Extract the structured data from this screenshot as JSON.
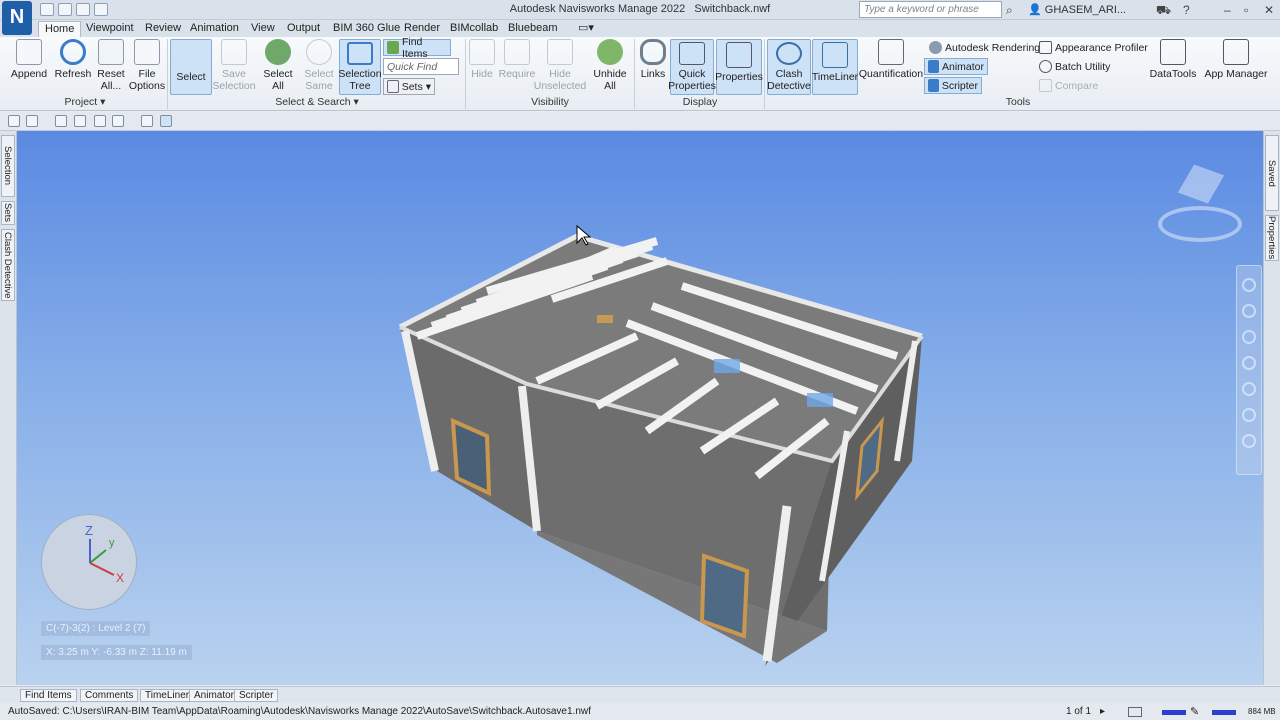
{
  "app": {
    "logo": "N",
    "title": "Autodesk Navisworks Manage 2022",
    "file": "Switchback.nwf",
    "search_placeholder": "Type a keyword or phrase",
    "user": "GHASEM_ARI..."
  },
  "tabs": [
    "Home",
    "Viewpoint",
    "Review",
    "Animation",
    "View",
    "Output",
    "BIM 360 Glue",
    "Render",
    "BIMcollab",
    "Bluebeam"
  ],
  "ribbon": {
    "project": {
      "append": "Append",
      "refresh": "Refresh",
      "reset": "Reset All...",
      "file_options": "File Options",
      "label": "Project"
    },
    "select": {
      "select": "Select",
      "save_selection": "Save Selection",
      "select_all": "Select All",
      "select_same": "Select Same",
      "selection_tree": "Selection Tree",
      "find_items": "Find Items",
      "quick_find": "Quick Find",
      "sets": "Sets",
      "label": "Select & Search"
    },
    "visibility": {
      "hide": "Hide",
      "require": "Require",
      "hide_unselected": "Hide Unselected",
      "unhide_all": "Unhide All",
      "label": "Visibility"
    },
    "display": {
      "links": "Links",
      "quick_properties": "Quick Properties",
      "properties": "Properties",
      "label": "Display"
    },
    "tools": {
      "clash_detective": "Clash Detective",
      "timeliner": "TimeLiner",
      "quantification": "Quantification",
      "autodesk_rendering": "Autodesk Rendering",
      "animator": "Animator",
      "scripter": "Scripter",
      "appearance_profiler": "Appearance Profiler",
      "batch_utility": "Batch Utility",
      "compare": "Compare",
      "datatools": "DataTools",
      "app_manager": "App Manager",
      "label": "Tools"
    }
  },
  "left_dock": [
    "Selection Tree",
    "Sets",
    "Clash Detective"
  ],
  "right_dock": [
    "Saved Viewpoints",
    "Properties"
  ],
  "viewport": {
    "level_info": "C(-7)-3(2) : Level 2 (7)",
    "coords": "X: 3.25 m  Y: -6.33 m  Z: 11.19 m",
    "axis": {
      "z": "Z",
      "y": "y",
      "x": "X"
    }
  },
  "bottom_tabs": [
    "Find Items",
    "Comments",
    "TimeLiner",
    "Animator",
    "Scripter"
  ],
  "status": {
    "path": "AutoSaved: C:\\Users\\IRAN-BIM Team\\AppData\\Roaming\\Autodesk\\Navisworks Manage 2022\\AutoSave\\Switchback.Autosave1.nwf",
    "page": "1 of 1",
    "memory": "884 MB"
  },
  "colors": {
    "accent": "#1e5fa8",
    "sky_top": "#5a8ae2",
    "sky_bottom": "#b9d2ef",
    "wall": "#6f6f6f",
    "beam": "#f2f2f2"
  }
}
